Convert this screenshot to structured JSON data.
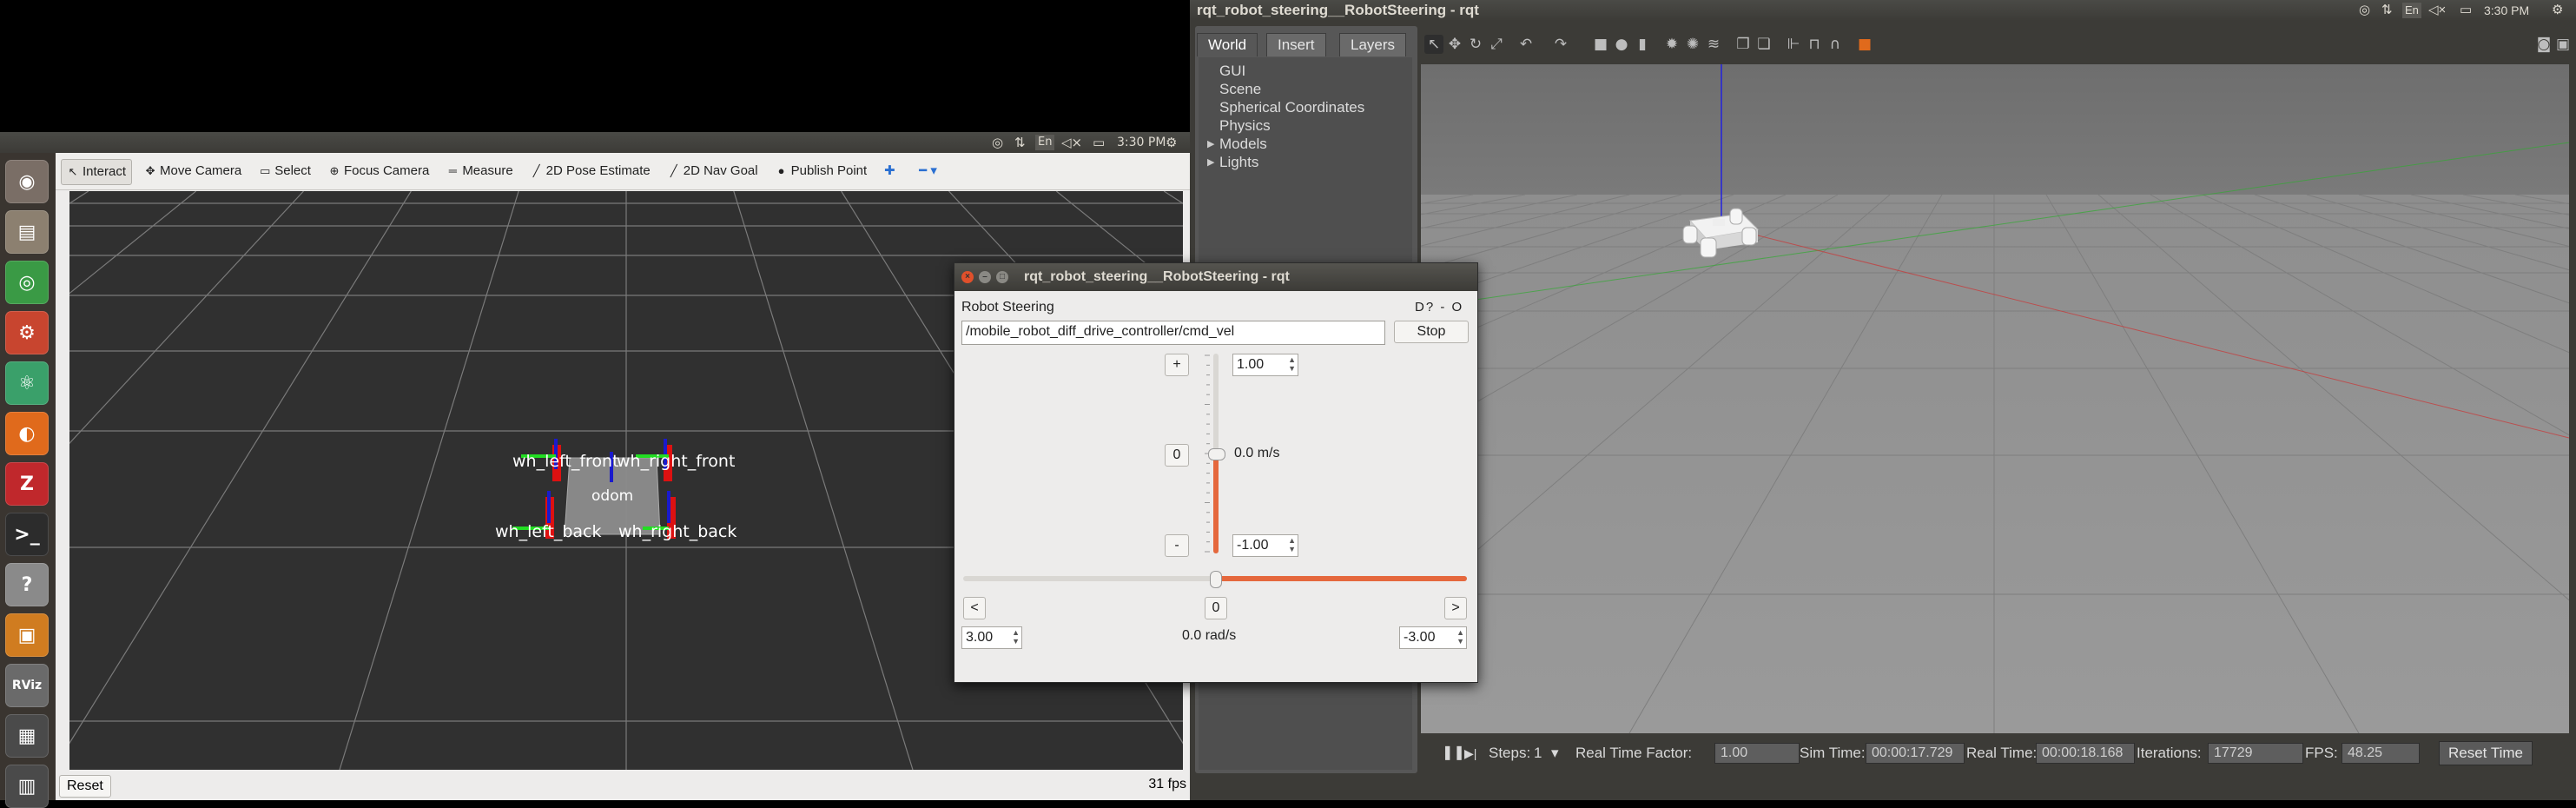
{
  "left_panel": {
    "topbar": {
      "time": "3:30 PM",
      "lang": "En"
    },
    "launcher": [
      {
        "name": "ubuntu-dash-icon",
        "glyph": "◉",
        "color": "#7a6e66"
      },
      {
        "name": "files-icon",
        "glyph": "▤",
        "color": "#8c8070"
      },
      {
        "name": "chrome-icon",
        "glyph": "◎",
        "color": "#3a9a45"
      },
      {
        "name": "settings-icon",
        "glyph": "⚙",
        "color": "#c8452f"
      },
      {
        "name": "atom-icon",
        "glyph": "⚛",
        "color": "#3aa06a"
      },
      {
        "name": "firefox-icon",
        "glyph": "◐",
        "color": "#e06a1c"
      },
      {
        "name": "zotero-icon",
        "glyph": "Z",
        "color": "#c0282c"
      },
      {
        "name": "terminal-icon",
        "glyph": ">_",
        "color": "#2c2c2c"
      },
      {
        "name": "help-icon",
        "glyph": "?",
        "color": "#8a8a8a"
      },
      {
        "name": "gazebo-icon",
        "glyph": "▣",
        "color": "#d07c20"
      },
      {
        "name": "rviz-icon",
        "glyph": "RViz",
        "color": "#6a6a6a"
      },
      {
        "name": "workspace-icon",
        "glyph": "▦",
        "color": "#4a4a4a"
      },
      {
        "name": "trash-icon",
        "glyph": "▥",
        "color": "#4a4a4a"
      }
    ],
    "rviz": {
      "tools": [
        {
          "label": "Interact",
          "icon": "↖",
          "name": "interact-tool"
        },
        {
          "label": "Move Camera",
          "icon": "✥",
          "name": "move-camera-tool"
        },
        {
          "label": "Select",
          "icon": "▭",
          "name": "select-tool"
        },
        {
          "label": "Focus Camera",
          "icon": "⊕",
          "name": "focus-camera-tool"
        },
        {
          "label": "Measure",
          "icon": "═",
          "name": "measure-tool"
        },
        {
          "label": "2D Pose Estimate",
          "icon": "╱",
          "name": "pose-estimate-tool"
        },
        {
          "label": "2D Nav Goal",
          "icon": "╱",
          "name": "nav-goal-tool"
        },
        {
          "label": "Publish Point",
          "icon": "●",
          "name": "publish-point-tool"
        }
      ],
      "frame_labels": {
        "left_front": "wh_left_front",
        "right_front": "wh_right_front",
        "left_back": "wh_left_back",
        "right_back": "wh_right_back",
        "base": "odom"
      },
      "reset_label": "Reset",
      "fps": "31 fps"
    }
  },
  "right_panel": {
    "title": "rqt_robot_steering__RobotSteering - rqt",
    "time": "3:30 PM",
    "lang": "En",
    "tabs": [
      "World",
      "Insert",
      "Layers"
    ],
    "world_items": [
      {
        "label": "GUI",
        "expandable": false
      },
      {
        "label": "Scene",
        "expandable": false
      },
      {
        "label": "Spherical Coordinates",
        "expandable": false
      },
      {
        "label": "Physics",
        "expandable": false
      },
      {
        "label": "Models",
        "expandable": true
      },
      {
        "label": "Lights",
        "expandable": true
      }
    ],
    "bottom": {
      "steps_label": "Steps:",
      "steps_value": "1",
      "rtf_label": "Real Time Factor:",
      "rtf_value": "1.00",
      "sim_time_label": "Sim Time:",
      "sim_time_value": "00:00:17.729",
      "real_time_label": "Real Time:",
      "real_time_value": "00:00:18.168",
      "iterations_label": "Iterations:",
      "iterations_value": "17729",
      "fps_label": "FPS:",
      "fps_value": "48.25",
      "reset_time_label": "Reset Time"
    }
  },
  "rqt": {
    "title": "rqt_robot_steering__RobotSteering - rqt",
    "plugin_name": "Robot Steering",
    "plugin_controls": "D? - O",
    "topic": "/mobile_robot_diff_drive_controller/cmd_vel",
    "stop_label": "Stop",
    "linear": {
      "plus": "+",
      "zero": "0",
      "minus": "-",
      "max": "1.00",
      "min": "-1.00",
      "value_label": "0.0 m/s",
      "value": 0.0
    },
    "angular": {
      "left": "<",
      "zero": "0",
      "right": ">",
      "max": "3.00",
      "min": "-3.00",
      "value_label": "0.0 rad/s",
      "value": 0.0
    }
  }
}
